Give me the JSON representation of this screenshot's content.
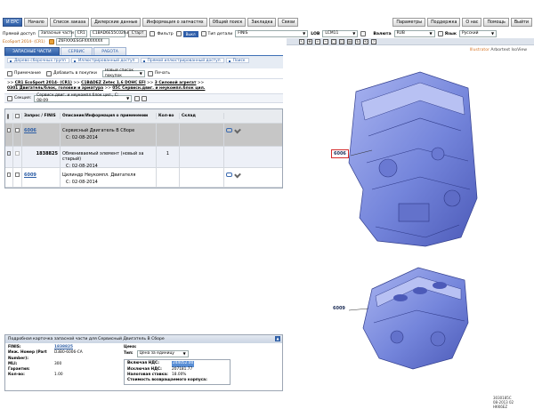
{
  "nav": {
    "left": [
      "И ЕРС",
      "Начало",
      "Список заказа",
      "Дилерские данные",
      "Информация о запчастях",
      "Общий поиск",
      "Закладка",
      "Связи"
    ],
    "right": [
      "Параметры",
      "Поддержка",
      "О нас",
      "Помощь",
      "Выйти"
    ]
  },
  "toolbar": {
    "quick_access_label": "Прямой доступ",
    "quick_access_value": "Запасные части",
    "cr_value": "CR1",
    "search_value": "C1BAD6E55C02634016",
    "start_label": "Старт",
    "filter_label": "Фильтр",
    "filter_value": "Выкл",
    "part_type_label": "Тип детали",
    "part_type_value": "FINIS",
    "lob_label": "LOB",
    "lob_value": "LCM11",
    "currency_label": "Валюта",
    "currency_value": "RUB",
    "lang_label": "Язык",
    "lang_value": "Русский"
  },
  "toolbar2": {
    "title": "EcoSport 2014- (CR1)",
    "vin": "Z6FXXXESGFXXXXXXX"
  },
  "tabs": [
    "ЗАПАСНЫЕ ЧАСТИ",
    "СЕРВИС",
    "РАБОТА"
  ],
  "views": [
    "Дерево сборочных групп",
    "Иллюстрированный доступ",
    "Прямой иллюстрированный доступ",
    "Поиск"
  ],
  "actions": {
    "note": "Примечание",
    "add_purchase": "Добавить в покупки",
    "new_list": "Новый список покупок",
    "print": "Печать"
  },
  "crumbs": {
    "p1": "CR1 EcoSport 2014- (CR1)",
    "p2": "C1BADEZ Zetec 1.6 DOHC EFI",
    "p3": "3 Силовой агрегат",
    "p4": "0301 Двигатель/блок, головки и арматура",
    "p5": "05C Сервисн.двиг. и неукомпл.блок цил."
  },
  "section": {
    "label": "Секция:",
    "value": "Сервисн.двиг. и неукомпл.блок цил., С: 08-09"
  },
  "table": {
    "headers": [
      "Запрос / FINIS",
      "Описание/Информация о применении",
      "Кол-во",
      "Склад"
    ],
    "rows": [
      {
        "num": "6006",
        "finis": "",
        "desc": "Сервисный Двигатель В Сборе",
        "sub": "С: 02-08-2014",
        "qty": "",
        "checked": false
      },
      {
        "num": "",
        "finis": "1838825",
        "desc": "Обмениваемый элемент (новый за старый)",
        "sub": "С: 02-08-2014",
        "qty": "1",
        "checked": true
      },
      {
        "num": "6009",
        "finis": "",
        "desc": "Цилиндр Неукомпл. Двигателя",
        "sub": "С: 02-08-2014",
        "qty": "",
        "checked": false
      }
    ]
  },
  "card": {
    "title": "Подробная карточка запасной части для Сервисный Двигатель В Сборе",
    "finis_k": "FINIS:",
    "finis_v": "1838825",
    "eng_k": "Инж. Номер (Part Number):",
    "eng_v": "D3B0-6006-CA",
    "mli_k": "MLI:",
    "mli_v": "300",
    "warranty_k": "Гарантия:",
    "warranty_v": "",
    "qty_k": "Кол-во:",
    "qty_v": "1.00",
    "price_label": "Цена:",
    "type_label": "Тип:",
    "type_value": "Цена за единицу",
    "vat_in_k": "Включая НДС:",
    "vat_in_v": "244052.00",
    "vat_ex_k": "Исключая НДС:",
    "vat_ex_v": "207181.77",
    "rate_k": "Налоговая ставка:",
    "rate_v": "18.00%",
    "core_k": "Стоимость возвращаемого корпуса:",
    "core_v": ""
  },
  "illustration": {
    "brand": "Arbortext IsoView",
    "edition": "Illustrator",
    "callout1": "6006",
    "callout2": "6009",
    "footer": [
      "3030185C",
      "08-2013 02",
      "HKK6EZ"
    ]
  },
  "colors": {
    "accent": "#2d5ea6",
    "engine": "#7f8fe0"
  }
}
